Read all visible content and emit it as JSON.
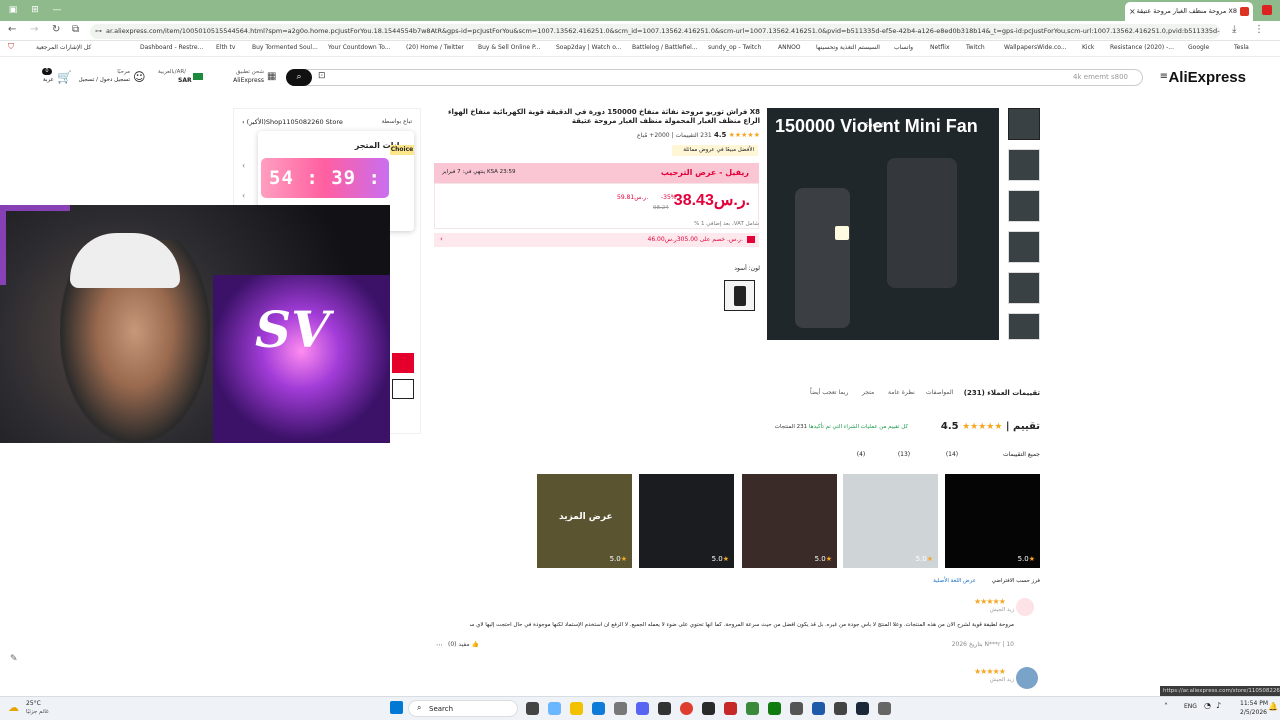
{
  "browser": {
    "active_tab_title": "X8 مروحة منظف الغبار مروحة عتيقة",
    "url": "ar.aliexpress.com/item/1005010515544564.html?spm=a2g0o.home.pcJustForYou.18.1544554b7w8AtR&gps-id=pcJustForYou&scm=1007.13562.416251.0&scm_id=1007.13562.416251.0&scm-url=1007.13562.416251.0&pvid=b511335d-ef5e-42b4-a126-e8ed0b318b14&_t=gps-id:pcJustForYou,scm-url:1007.13562.416251.0,pvid:b511335d-ef5e-42b4-a12...",
    "bookmarks": [
      "كل الإشارات المرجعية",
      "Dashboard - Restre...",
      "Elth tv",
      "Buy Tormented Soul...",
      "Your Countdown To...",
      "(20) Home / Twitter",
      "Buy & Sell Online P...",
      "Soap2day | Watch o...",
      "Battlelog / Battlefiel...",
      "sundy_op - Twitch",
      "ANNOO",
      "السيستم التغذية وتحسينها",
      "واتساب",
      "Netflix",
      "Twitch",
      "WallpapersWide.co...",
      "Kick",
      "Resistance (2020) -...",
      "Google",
      "Tesla"
    ]
  },
  "header": {
    "logo": "AliExpress",
    "search_placeholder": "4k ememt s800",
    "ship_label": "شحن تطبيق",
    "ship_value": "AliExpress",
    "region_label": "بالعربية/AR/",
    "currency": "SAR",
    "account_label": "مرحبًا",
    "account_value": "تسجيل دخول / تسجيل",
    "cart_label": "عربة",
    "cart_count": "0"
  },
  "product": {
    "title": "X8 فراش توربو مروحة نفاثة منفاخ 150000 دورة في الدقيقة قوية الكهربائية منفاخ الهواء الراع منظف الغبار المحمولة منظف الغبار مروحة عتيقة",
    "rating": "4.5",
    "rating_summary": "231 التقييمات  |  2000+ مُباع",
    "deal_badge": "الأفضل مبيعًا في عروض مماثلة",
    "welcome_deal": "ريفيل - عرض الترحيب",
    "deal_end": "ينتهي في: 7 فبراير KSA 23:59",
    "price": "38.43ر.س.",
    "original_price": "59.81ر.س.",
    "discount": "-35%",
    "old_price_small": "98.24",
    "tax_note": "شامل VAT، بعد إضافي 1 %",
    "coupon": "46.00ر.س. خصم على 305.00ر.س.",
    "color_label": "لون: أسود",
    "gallery_title": "150000 Violent Mini Fan",
    "gallery_subtitle": "Speed"
  },
  "store": {
    "sold_by_label": "تباع بواسطة",
    "store_name": "(الأكبر)Shop1105082260 Store",
    "panel_title": "بيانات المتجر",
    "timer": "54 : 39 : 19",
    "choice_label": "Choice"
  },
  "tabs": [
    "تقييمات العملاء (231)",
    "المواصفات",
    "نظرة عامة",
    "متجر",
    "ربما تعجب أيضاً"
  ],
  "reviews": {
    "score": "4.5",
    "heading": "تقييم",
    "count": "231 المنتجات",
    "verified": "كل تقييم من عمليات الشراء التي تم تأكيدها",
    "filters": [
      "جميع التقييمات",
      "(14)",
      "(13)",
      "(4)"
    ],
    "images_overlay": "عرض المزيد",
    "image_ratings": [
      "5.0",
      "5.0",
      "5.0",
      "5.0",
      "5.0"
    ],
    "sort_label": "فرز حسب الافتراضي",
    "sort_option": "عرض اللغة الأصلية",
    "first_review": {
      "author": "زيد الجيش",
      "text": "مروحة لطيفة قوية لشرح الآن من هذه المنتجات. وعلا المنتج لا بأس جودة من غيره. بل قد يكون أفضل من حيث سرعة المروحة. كما أنها تحتوي على ضوء لا يعمله الجميع. لا الرفع أن أستخدم الإستماد لكنها موجودة في حال احتجت إليها لأي سبب كان.",
      "meta": "10 | N***r بتاريخ 2026",
      "helpful": "مفيد (0)"
    },
    "second_review_author": "زيد الجيش"
  },
  "taskbar": {
    "weather": "25°C",
    "weather_desc": "غائم جزئيًا",
    "search": "Search",
    "lang": "ENG",
    "time": "11:54 PM",
    "date": "2/5/2026"
  },
  "status_url": "https://ar.aliexpress.com/store/1105082260"
}
